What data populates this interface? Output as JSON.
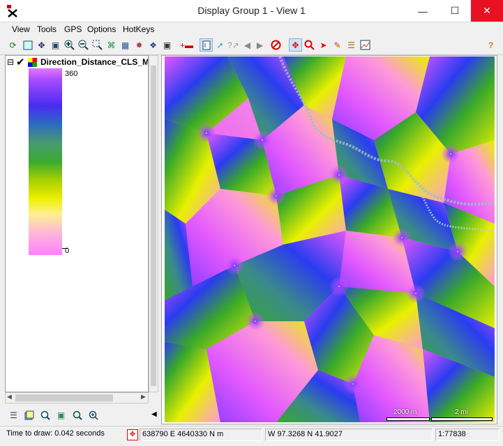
{
  "window": {
    "title": "Display Group 1 - View 1",
    "minimize_label": "—",
    "maximize_label": "☐",
    "close_label": "✕"
  },
  "menu": [
    "View",
    "Tools",
    "GPS",
    "Options",
    "HotKeys"
  ],
  "toolbar": {
    "help_label": "?"
  },
  "layer": {
    "name": "Direction_Distance_CLS_Mi",
    "expand_label": "⊟",
    "visible_check": "✔",
    "max_label": "360",
    "min_label": "0"
  },
  "scale": {
    "metric": "2000 m",
    "imperial": "2 mi"
  },
  "status": {
    "time_to_draw": "Time to draw: 0.042 seconds",
    "projected": "638790 E  4640330 N m",
    "geographic": "W 97.3268  N 41.9027",
    "map_scale": "1:77838"
  },
  "colors": {
    "magenta": "#e258ff",
    "violet": "#8a3cff",
    "blue": "#2a3cf0",
    "teal": "#3a8a8a",
    "green": "#38a82a",
    "yellow": "#e8f000",
    "pink": "#ff9ad8"
  }
}
